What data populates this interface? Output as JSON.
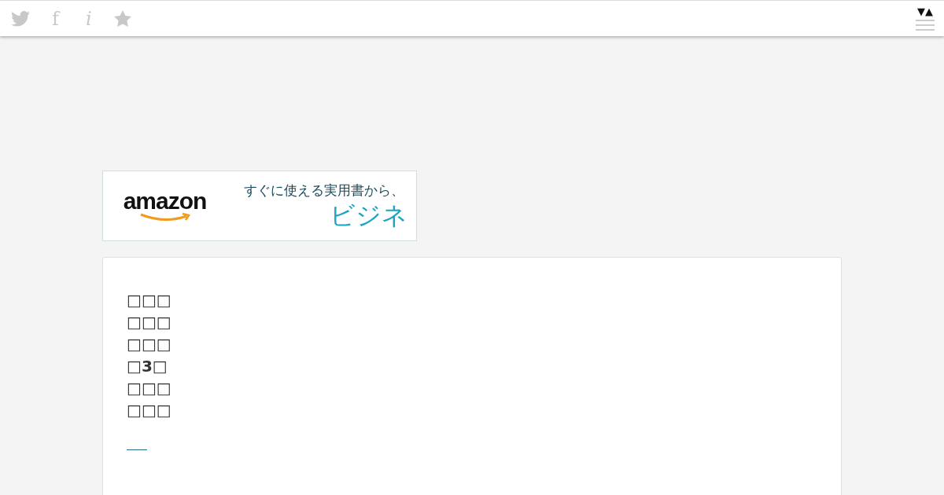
{
  "top_bar": {
    "icons": [
      {
        "kind": "bird"
      },
      {
        "kind": "glyph",
        "text": "f"
      },
      {
        "kind": "glyph-italic",
        "text": "i"
      },
      {
        "kind": "star"
      }
    ],
    "toggle": "▼▲"
  },
  "banner": {
    "logo": "amazon",
    "tagline": "すぐに使える実用書から、",
    "headline": "ビジネ"
  },
  "article": {
    "lines": [
      "□□□",
      "□□□",
      "□□□",
      "□**3**□",
      "□□□",
      "□□□"
    ],
    "link": true
  }
}
